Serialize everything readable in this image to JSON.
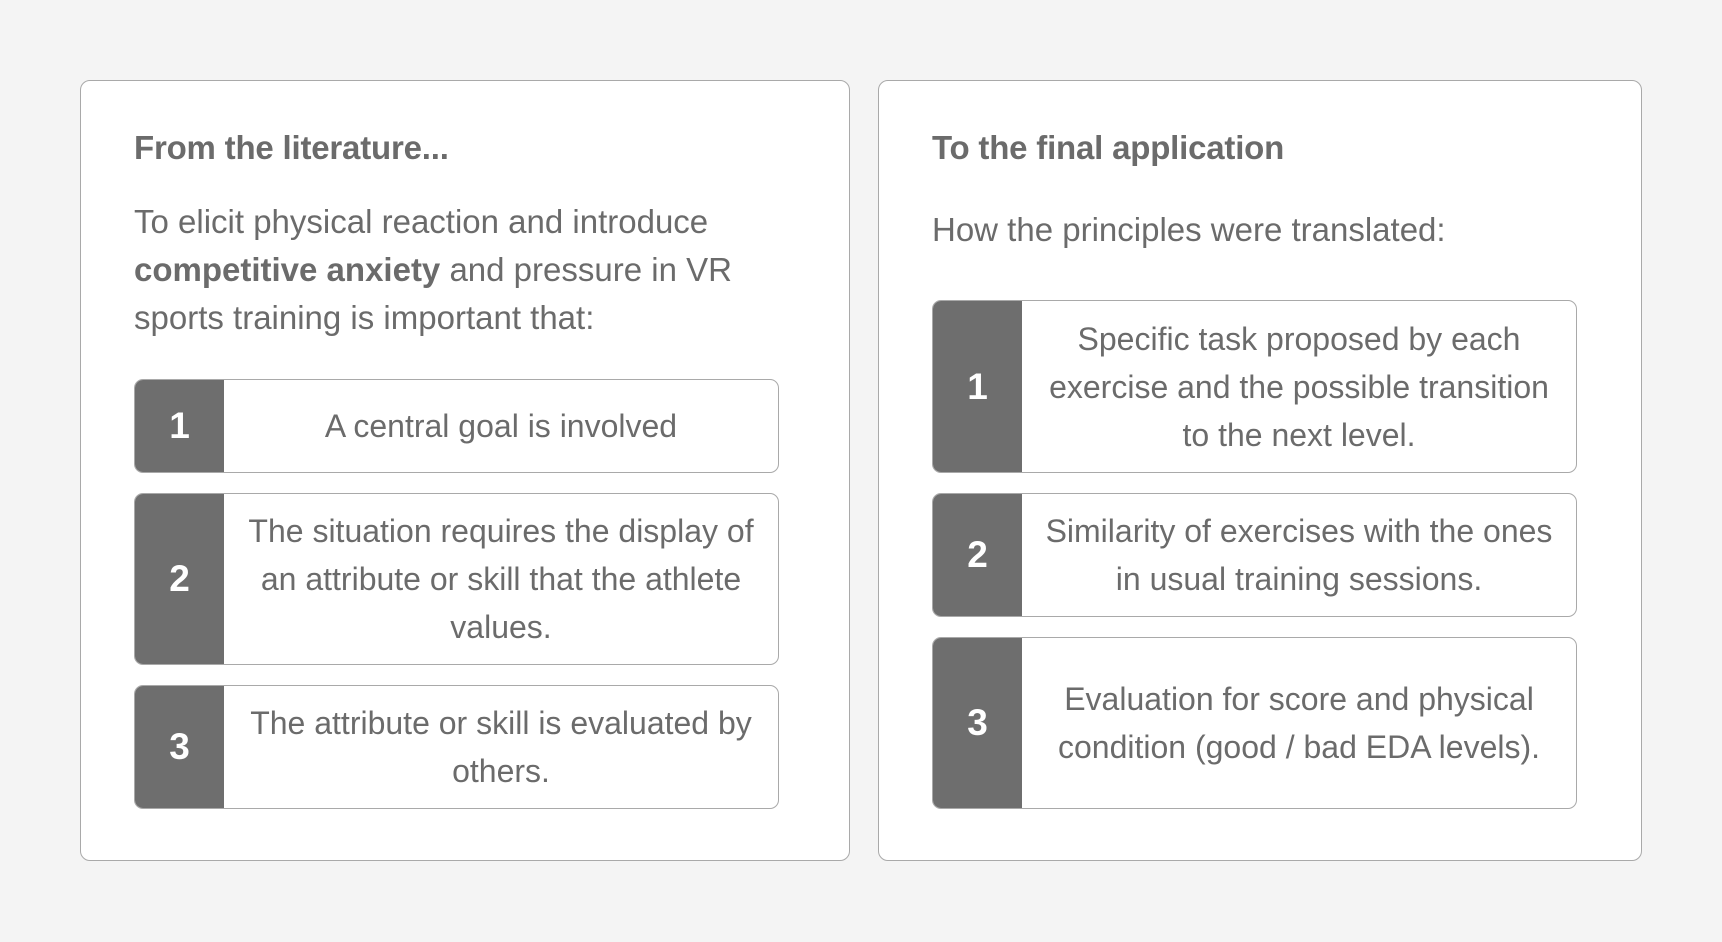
{
  "left_panel": {
    "title": "From the literature...",
    "intro_part1": "To elicit physical reaction and introduce ",
    "intro_bold": "competitive anxiety",
    "intro_part2": " and pressure in VR sports training is important that:",
    "items": [
      {
        "number": "1",
        "text": "A central goal is involved"
      },
      {
        "number": "2",
        "text": "The situation requires the display of an attribute or skill that the athlete values."
      },
      {
        "number": "3",
        "text": "The attribute or skill is evaluated by others."
      }
    ]
  },
  "right_panel": {
    "title": "To the final application",
    "intro": "How the principles were translated:",
    "items": [
      {
        "number": "1",
        "text": "Specific task proposed by each exercise and the possible transition to the next level."
      },
      {
        "number": "2",
        "text": "Similarity of exercises with the ones in usual training sessions."
      },
      {
        "number": "3",
        "text": "Evaluation for score and physical condition (good / bad EDA levels)."
      }
    ]
  },
  "colors": {
    "background": "#f4f4f4",
    "panel": "#ffffff",
    "number_box": "#6e6e6e",
    "text": "#6b6b6b",
    "border": "#a9a9a9"
  }
}
